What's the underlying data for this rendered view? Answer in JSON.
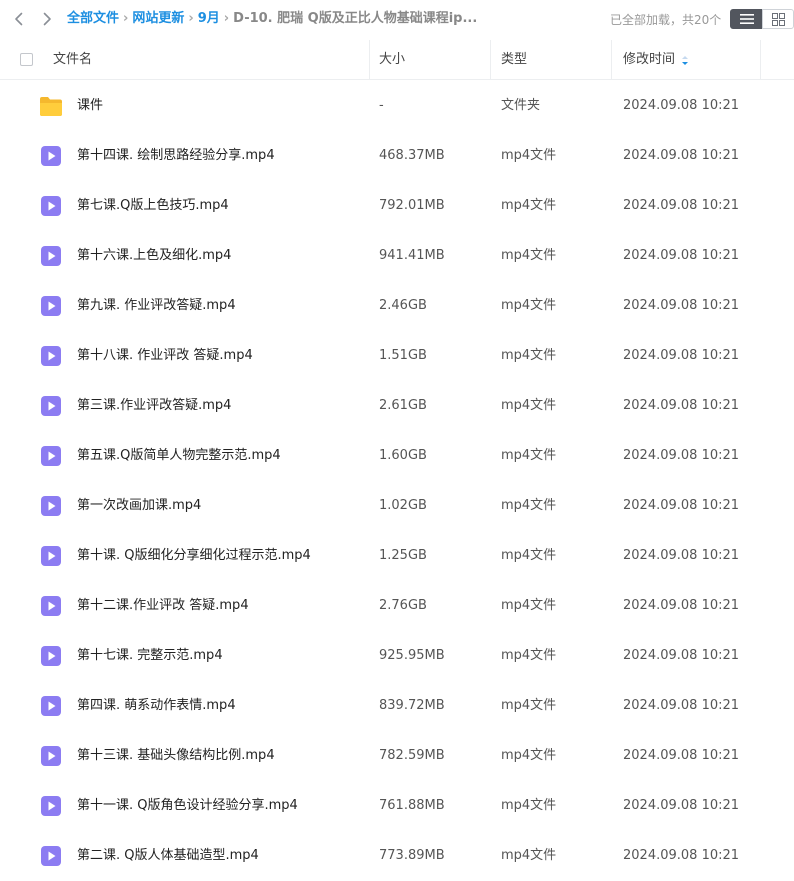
{
  "breadcrumb": {
    "items": [
      "全部文件",
      "网站更新",
      "9月"
    ],
    "current": "D-10. 肥瑞 Q版及正比人物基础课程ip..."
  },
  "status": {
    "loaded_text": "已全部加载，共20个"
  },
  "columns": {
    "name": "文件名",
    "size": "大小",
    "type": "类型",
    "modified": "修改时间"
  },
  "colors": {
    "accent": "#1d8fe1",
    "video_icon": "#8c7cf2",
    "folder_icon": "#f7c12e"
  },
  "files": [
    {
      "name": "课件",
      "size": "-",
      "type": "文件夹",
      "modified": "2024.09.08 10:21",
      "icon": "folder-icon"
    },
    {
      "name": "第十四课. 绘制思路经验分享.mp4",
      "size": "468.37MB",
      "type": "mp4文件",
      "modified": "2024.09.08 10:21",
      "icon": "video-file-icon"
    },
    {
      "name": "第七课.Q版上色技巧.mp4",
      "size": "792.01MB",
      "type": "mp4文件",
      "modified": "2024.09.08 10:21",
      "icon": "video-file-icon"
    },
    {
      "name": "第十六课.上色及细化.mp4",
      "size": "941.41MB",
      "type": "mp4文件",
      "modified": "2024.09.08 10:21",
      "icon": "video-file-icon"
    },
    {
      "name": "第九课. 作业评改答疑.mp4",
      "size": "2.46GB",
      "type": "mp4文件",
      "modified": "2024.09.08 10:21",
      "icon": "video-file-icon"
    },
    {
      "name": "第十八课. 作业评改 答疑.mp4",
      "size": "1.51GB",
      "type": "mp4文件",
      "modified": "2024.09.08 10:21",
      "icon": "video-file-icon"
    },
    {
      "name": "第三课.作业评改答疑.mp4",
      "size": "2.61GB",
      "type": "mp4文件",
      "modified": "2024.09.08 10:21",
      "icon": "video-file-icon"
    },
    {
      "name": "第五课.Q版简单人物完整示范.mp4",
      "size": "1.60GB",
      "type": "mp4文件",
      "modified": "2024.09.08 10:21",
      "icon": "video-file-icon"
    },
    {
      "name": "第一次改画加课.mp4",
      "size": "1.02GB",
      "type": "mp4文件",
      "modified": "2024.09.08 10:21",
      "icon": "video-file-icon"
    },
    {
      "name": "第十课. Q版细化分享细化过程示范.mp4",
      "size": "1.25GB",
      "type": "mp4文件",
      "modified": "2024.09.08 10:21",
      "icon": "video-file-icon"
    },
    {
      "name": "第十二课.作业评改 答疑.mp4",
      "size": "2.76GB",
      "type": "mp4文件",
      "modified": "2024.09.08 10:21",
      "icon": "video-file-icon"
    },
    {
      "name": "第十七课. 完整示范.mp4",
      "size": "925.95MB",
      "type": "mp4文件",
      "modified": "2024.09.08 10:21",
      "icon": "video-file-icon"
    },
    {
      "name": "第四课. 萌系动作表情.mp4",
      "size": "839.72MB",
      "type": "mp4文件",
      "modified": "2024.09.08 10:21",
      "icon": "video-file-icon"
    },
    {
      "name": "第十三课. 基础头像结构比例.mp4",
      "size": "782.59MB",
      "type": "mp4文件",
      "modified": "2024.09.08 10:21",
      "icon": "video-file-icon"
    },
    {
      "name": "第十一课. Q版角色设计经验分享.mp4",
      "size": "761.88MB",
      "type": "mp4文件",
      "modified": "2024.09.08 10:21",
      "icon": "video-file-icon"
    },
    {
      "name": "第二课. Q版人体基础造型.mp4",
      "size": "773.89MB",
      "type": "mp4文件",
      "modified": "2024.09.08 10:21",
      "icon": "video-file-icon"
    }
  ]
}
